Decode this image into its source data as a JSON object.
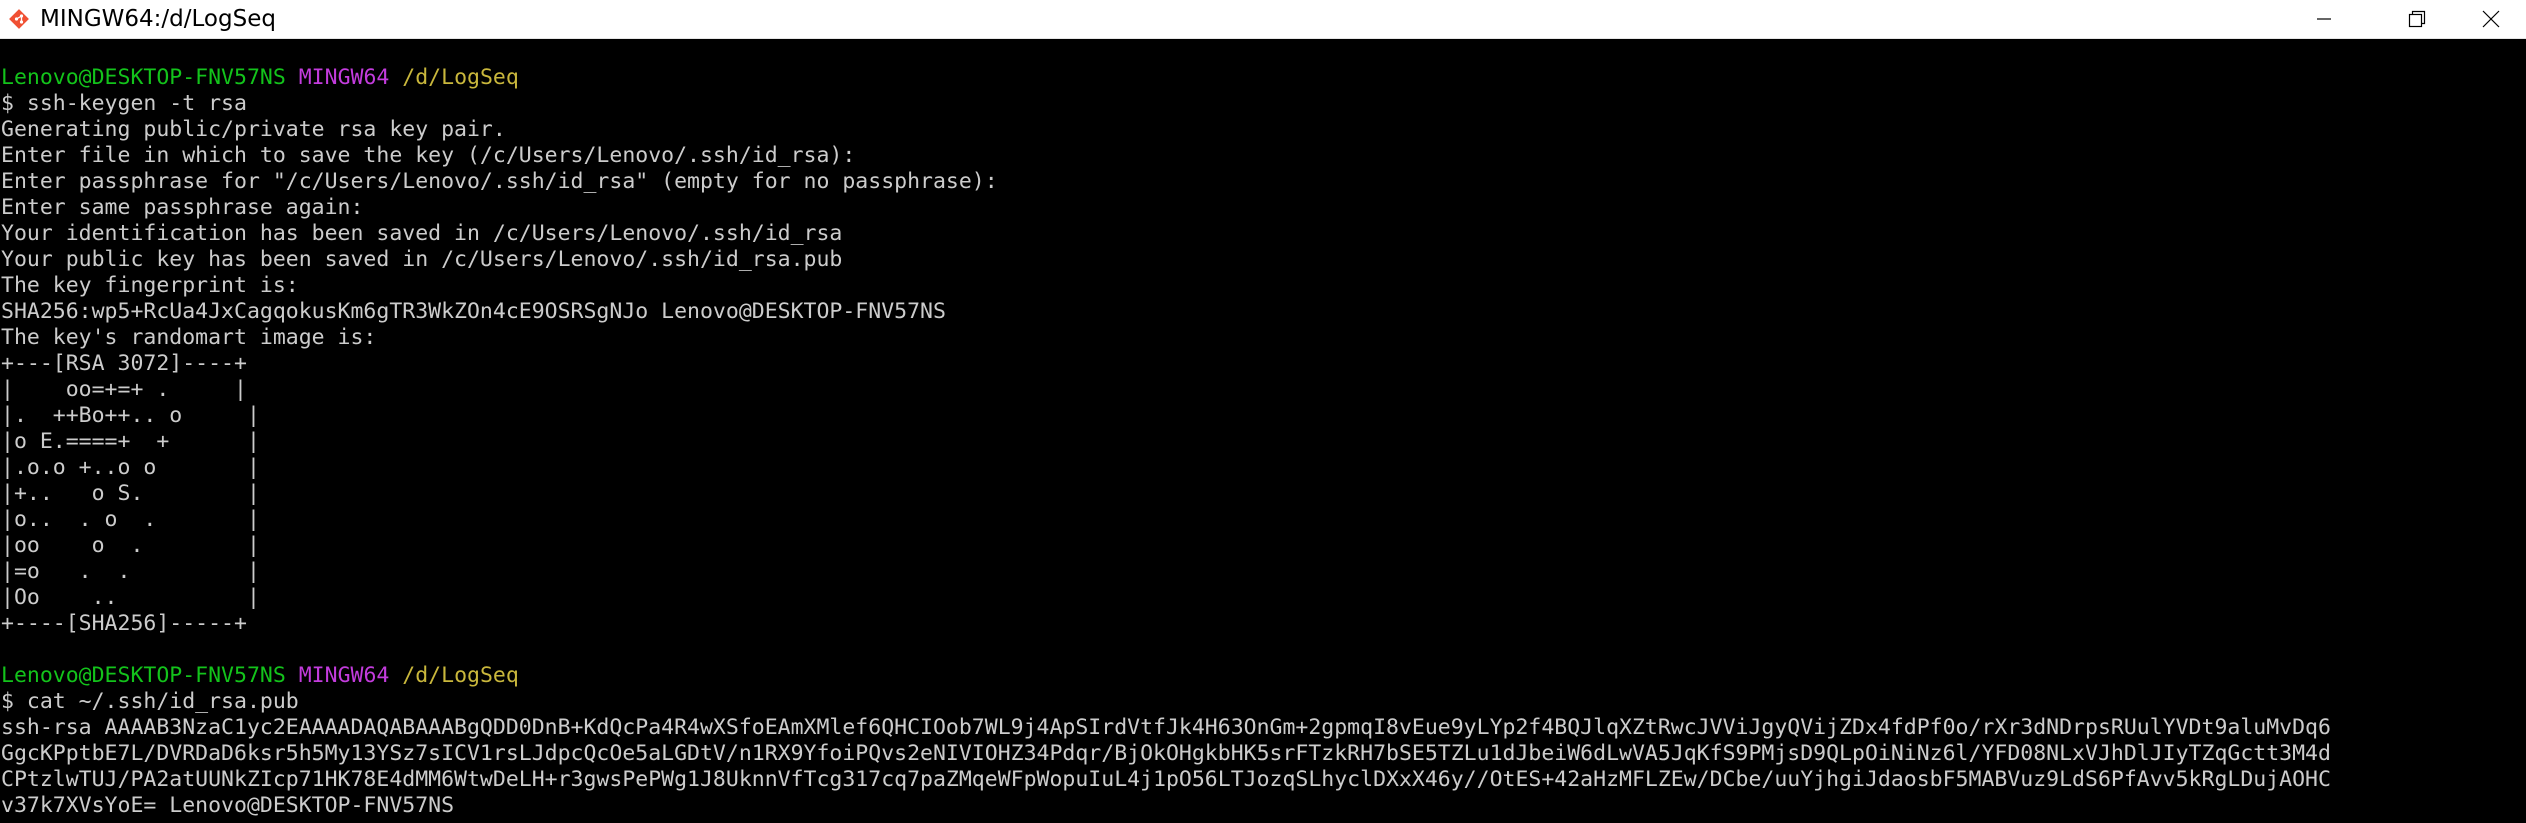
{
  "window": {
    "title": "MINGW64:/d/LogSeq",
    "icon": "git-bash-icon",
    "controls": [
      "minimize-icon",
      "maximize-icon",
      "close-icon"
    ]
  },
  "prompt": {
    "user_host": "Lenovo@DESKTOP-FNV57NS",
    "shell": "MINGW64",
    "cwd": "/d/LogSeq",
    "symbol": "$ "
  },
  "colors": {
    "background": "#000000",
    "foreground": "#cccccc",
    "user_host": "#13c31b",
    "shell": "#c33cdd",
    "cwd": "#c9b73c"
  },
  "session": {
    "cmd1": "ssh-keygen -t rsa",
    "output1": [
      "Generating public/private rsa key pair.",
      "Enter file in which to save the key (/c/Users/Lenovo/.ssh/id_rsa):",
      "Enter passphrase for \"/c/Users/Lenovo/.ssh/id_rsa\" (empty for no passphrase):",
      "Enter same passphrase again:",
      "Your identification has been saved in /c/Users/Lenovo/.ssh/id_rsa",
      "Your public key has been saved in /c/Users/Lenovo/.ssh/id_rsa.pub",
      "The key fingerprint is:",
      "SHA256:wp5+RcUa4JxCagqokusKm6gTR3WkZOn4cE9OSRSgNJo Lenovo@DESKTOP-FNV57NS",
      "The key's randomart image is:"
    ],
    "randomart": [
      "+---[RSA 3072]----+",
      "|    oo=+=+ .     |",
      "|.  ++Bo++.. o     |",
      "|o E.====+  +      |",
      "|.o.o +..o o       |",
      "|+..   o S.        |",
      "|o..  . o  .       |",
      "|oo    o  .        |",
      "|=o   .  .         |",
      "|Oo    ..          |",
      "+----[SHA256]-----+"
    ],
    "cmd2": "cat ~/.ssh/id_rsa.pub",
    "output2": [
      "ssh-rsa AAAAB3NzaC1yc2EAAAADAQABAAABgQDD0DnB+KdQcPa4R4wXSfoEAmXMlef6QHCIOob7WL9j4ApSIrdVtfJk4H63OnGm+2gpmqI8vEue9yLYp2f4BQJlqXZtRwcJVViJgyQVijZDx4fdPf0o/rXr3dNDrpsRUulYVDt9aluMvDq6",
      "GgcKPptbE7L/DVRDaD6ksr5h5My13YSz7sICV1rsLJdpcQcOe5aLGDtV/n1RX9YfoiPQvs2eNIVIOHZ34Pdqr/BjOkOHgkbHK5srFTzkRH7bSE5TZLu1dJbeiW6dLwVA5JqKfS9PMjsD9QLpOiNiNz6l/YFD08NLxVJhDlJIyTZqGctt3M4d",
      "CPtzlwTUJ/PA2atUUNkZIcp71HK78E4dMM6WtwDeLH+r3gwsPePWg1J8UknnVfTcg317cq7paZMqeWFpWopuIuL4j1pO56LTJozqSLhyclDXxX46y//OtES+42aHzMFLZEw/DCbe/uuYjhgiJdaosbF5MABVuz9LdS6PfAvv5kRgLDujAOHC",
      "v37k7XVsYoE= Lenovo@DESKTOP-FNV57NS"
    ]
  }
}
